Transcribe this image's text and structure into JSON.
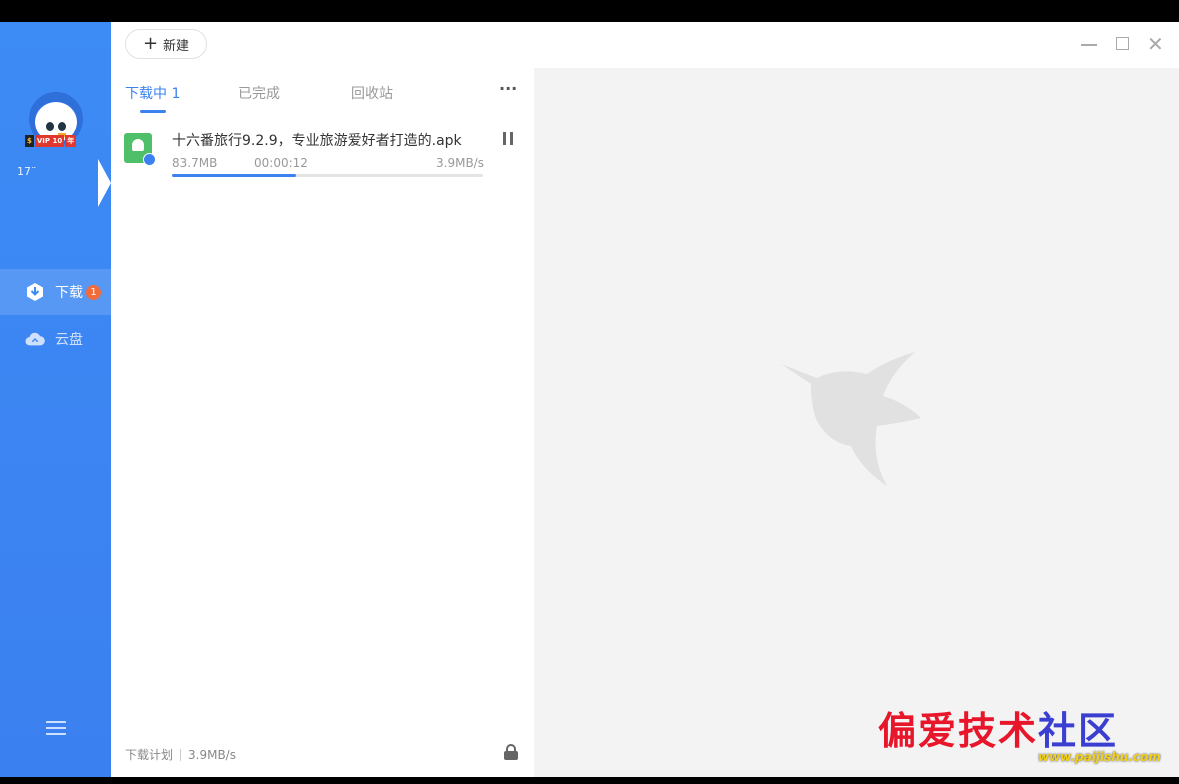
{
  "sidebar": {
    "vip": {
      "s": "$",
      "level": "VIP 10",
      "tag": "年"
    },
    "username": "17¨",
    "items": [
      {
        "label": "下载",
        "badge": "1"
      },
      {
        "label": "云盘"
      }
    ]
  },
  "toolbar": {
    "new_label": "新建"
  },
  "tabs": {
    "downloading": "下载中 1",
    "completed": "已完成",
    "recycle": "回收站",
    "more": "···"
  },
  "download": {
    "filename": "十六番旅行9.2.9，专业旅游爱好者打造的.apk",
    "size": "83.7MB",
    "elapsed": "00:00:12",
    "speed": "3.9MB/s",
    "progress_fraction": 0.4
  },
  "footer": {
    "plan_label": "下载计划",
    "speed": "3.9MB/s"
  },
  "window_controls": {
    "close": "✕"
  },
  "watermark": {
    "text_red": "偏爱技术",
    "text_blue": "社区",
    "url": "www.paijishu.com"
  },
  "colors": {
    "accent": "#3b82f0",
    "sidebar": "#3d8bf5",
    "badge": "#f26b3a"
  }
}
